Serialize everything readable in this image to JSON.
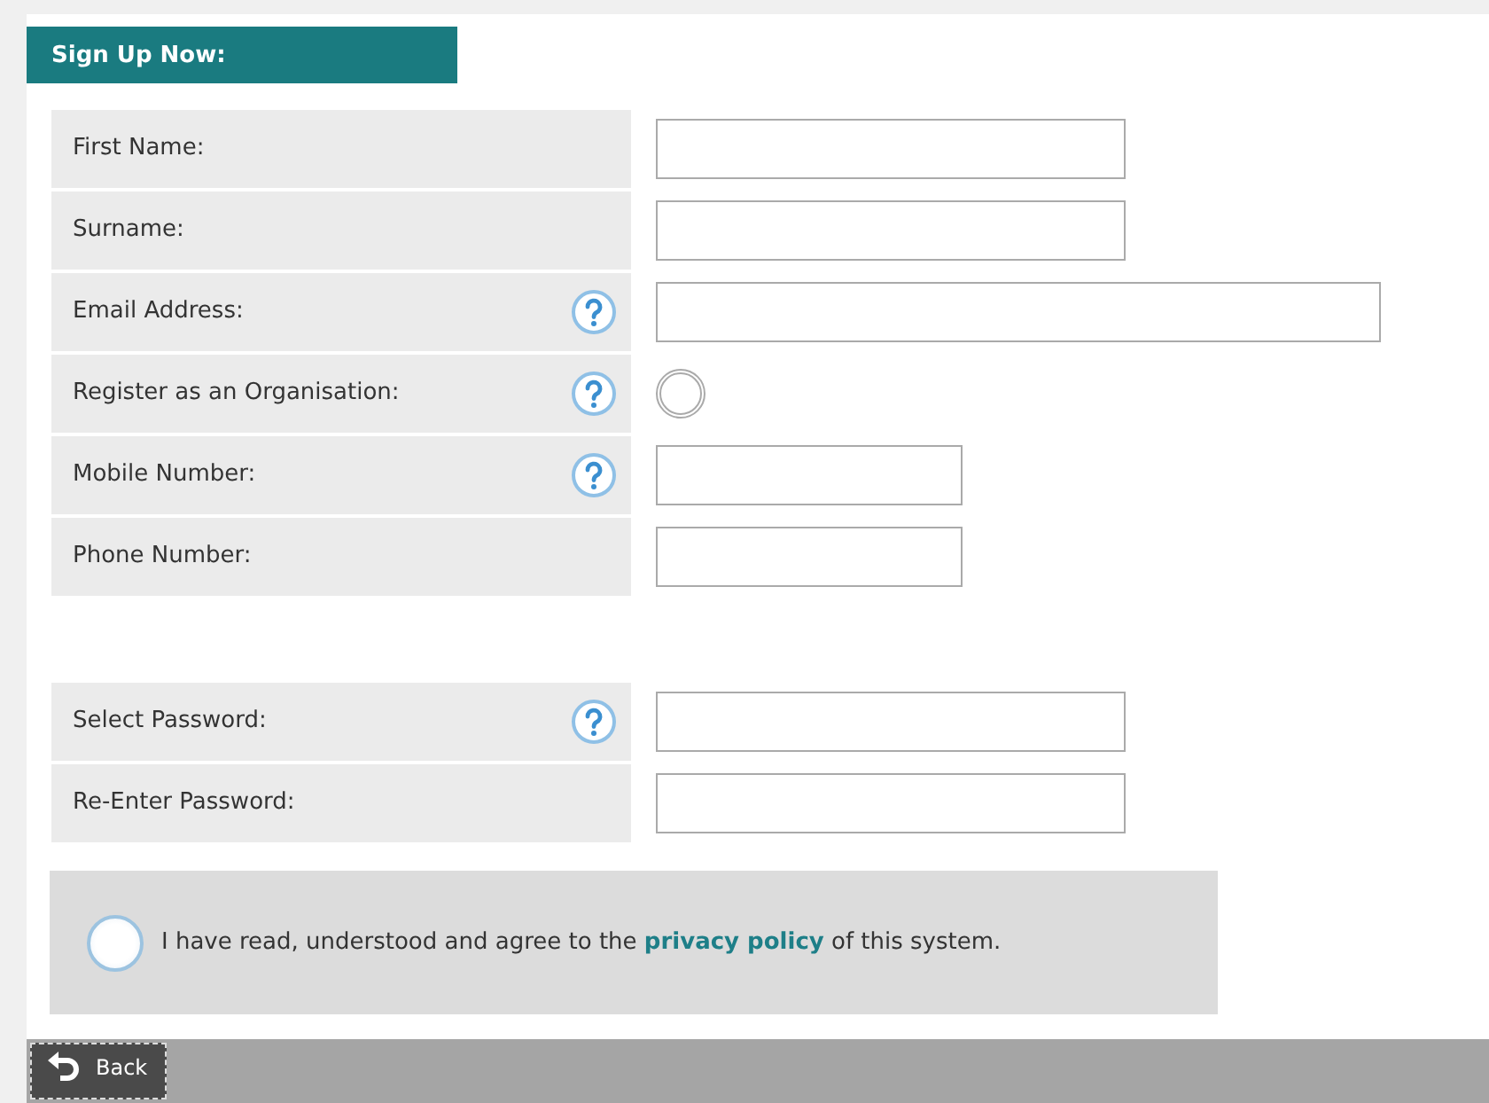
{
  "header": {
    "title": "Sign Up Now:"
  },
  "groups": [
    {
      "fields": [
        {
          "label": "First Name:",
          "help": false,
          "kind": "text"
        },
        {
          "label": "Surname:",
          "help": false,
          "kind": "text"
        },
        {
          "label": "Email Address:",
          "help": true,
          "kind": "long-text"
        },
        {
          "label": "Register as an Organisation:",
          "help": true,
          "kind": "radio",
          "checked": false
        },
        {
          "label": "Mobile Number:",
          "help": true,
          "kind": "short-text"
        },
        {
          "label": "Phone Number:",
          "help": false,
          "kind": "short-text"
        }
      ]
    },
    {
      "fields": [
        {
          "label": "Select Password:",
          "help": true,
          "kind": "text"
        },
        {
          "label": "Re-Enter Password:",
          "help": false,
          "kind": "text"
        }
      ]
    }
  ],
  "agreement": {
    "checked": false,
    "before": "I have read, understood and agree to the",
    "link": "privacy policy",
    "after": "of this system."
  },
  "footer": {
    "back": "Back"
  }
}
